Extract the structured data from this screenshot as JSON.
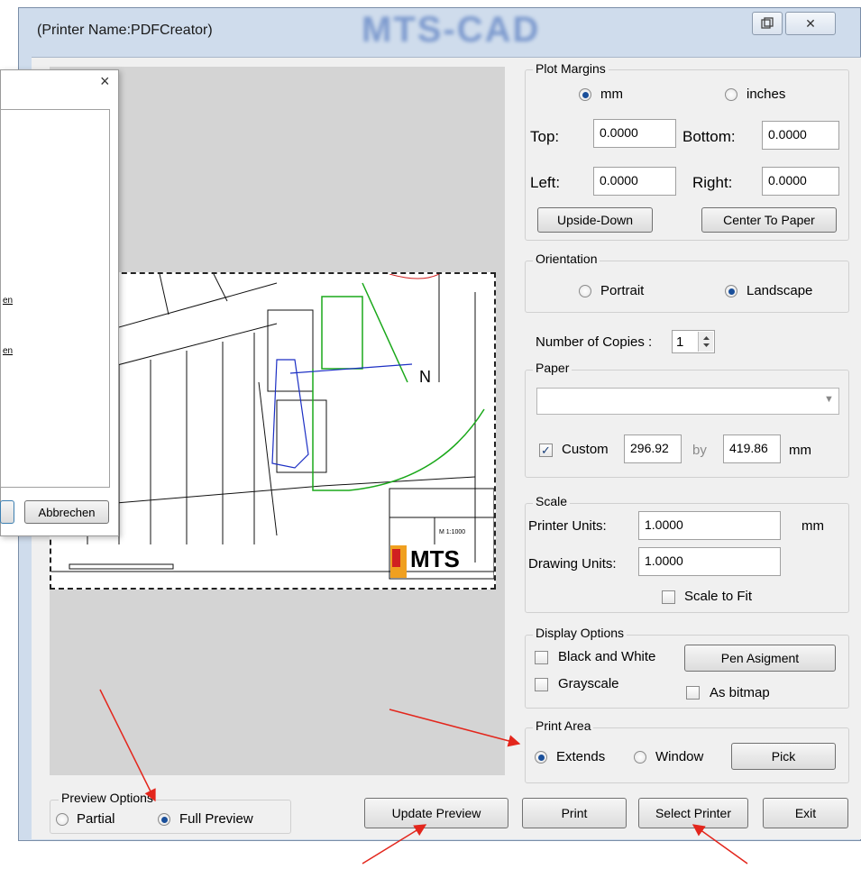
{
  "window": {
    "title": "(Printer Name:PDFCreator)",
    "logo_text": "MTS-CAD"
  },
  "titlebar": {
    "restore_icon": "restore-icon",
    "close_label": "✕"
  },
  "plot_margins": {
    "label": "Plot Margins",
    "unit_mm": "mm",
    "unit_inches": "inches",
    "selected_unit": "mm",
    "top_label": "Top:",
    "top_value": "0.0000",
    "bottom_label": "Bottom:",
    "bottom_value": "0.0000",
    "left_label": "Left:",
    "left_value": "0.0000",
    "right_label": "Right:",
    "right_value": "0.0000",
    "upside_down": "Upside-Down",
    "center_to_paper": "Center To Paper"
  },
  "orientation": {
    "label": "Orientation",
    "portrait": "Portrait",
    "landscape": "Landscape",
    "selected": "Landscape"
  },
  "copies": {
    "label": "Number of Copies :",
    "value": "1"
  },
  "paper": {
    "label": "Paper",
    "selected": "",
    "custom_label": "Custom",
    "custom_checked": true,
    "width": "296.92",
    "by": "by",
    "height": "419.86",
    "unit": "mm"
  },
  "scale": {
    "label": "Scale",
    "printer_units_label": "Printer Units:",
    "printer_units_value": "1.0000",
    "printer_units_unit": "mm",
    "drawing_units_label": "Drawing Units:",
    "drawing_units_value": "1.0000",
    "scale_to_fit": "Scale to Fit"
  },
  "display_options": {
    "label": "Display Options",
    "black_white": "Black and White",
    "pen_assignment": "Pen Asigment",
    "grayscale": "Grayscale",
    "as_bitmap": "As bitmap"
  },
  "print_area": {
    "label": "Print Area",
    "extends": "Extends",
    "window": "Window",
    "selected": "Extends",
    "pick": "Pick"
  },
  "preview_options": {
    "label": "Preview Options",
    "partial": "Partial",
    "full": "Full Preview",
    "selected": "Full Preview"
  },
  "buttons": {
    "update_preview": "Update Preview",
    "print": "Print",
    "select_printer": "Select Printer",
    "exit": "Exit"
  },
  "drawing": {
    "north_label": "N",
    "title_block_logo": "MTS",
    "title_block_scale": "M 1:1000"
  },
  "overlay_dialog": {
    "close_label": "×",
    "cancel": "Abbrechen",
    "link_1": "en",
    "link_2": "en"
  },
  "colors": {
    "annotation_arrow": "#e3261c",
    "window_frame": "#cfdcec",
    "radio_selected": "#1a4f9a"
  }
}
